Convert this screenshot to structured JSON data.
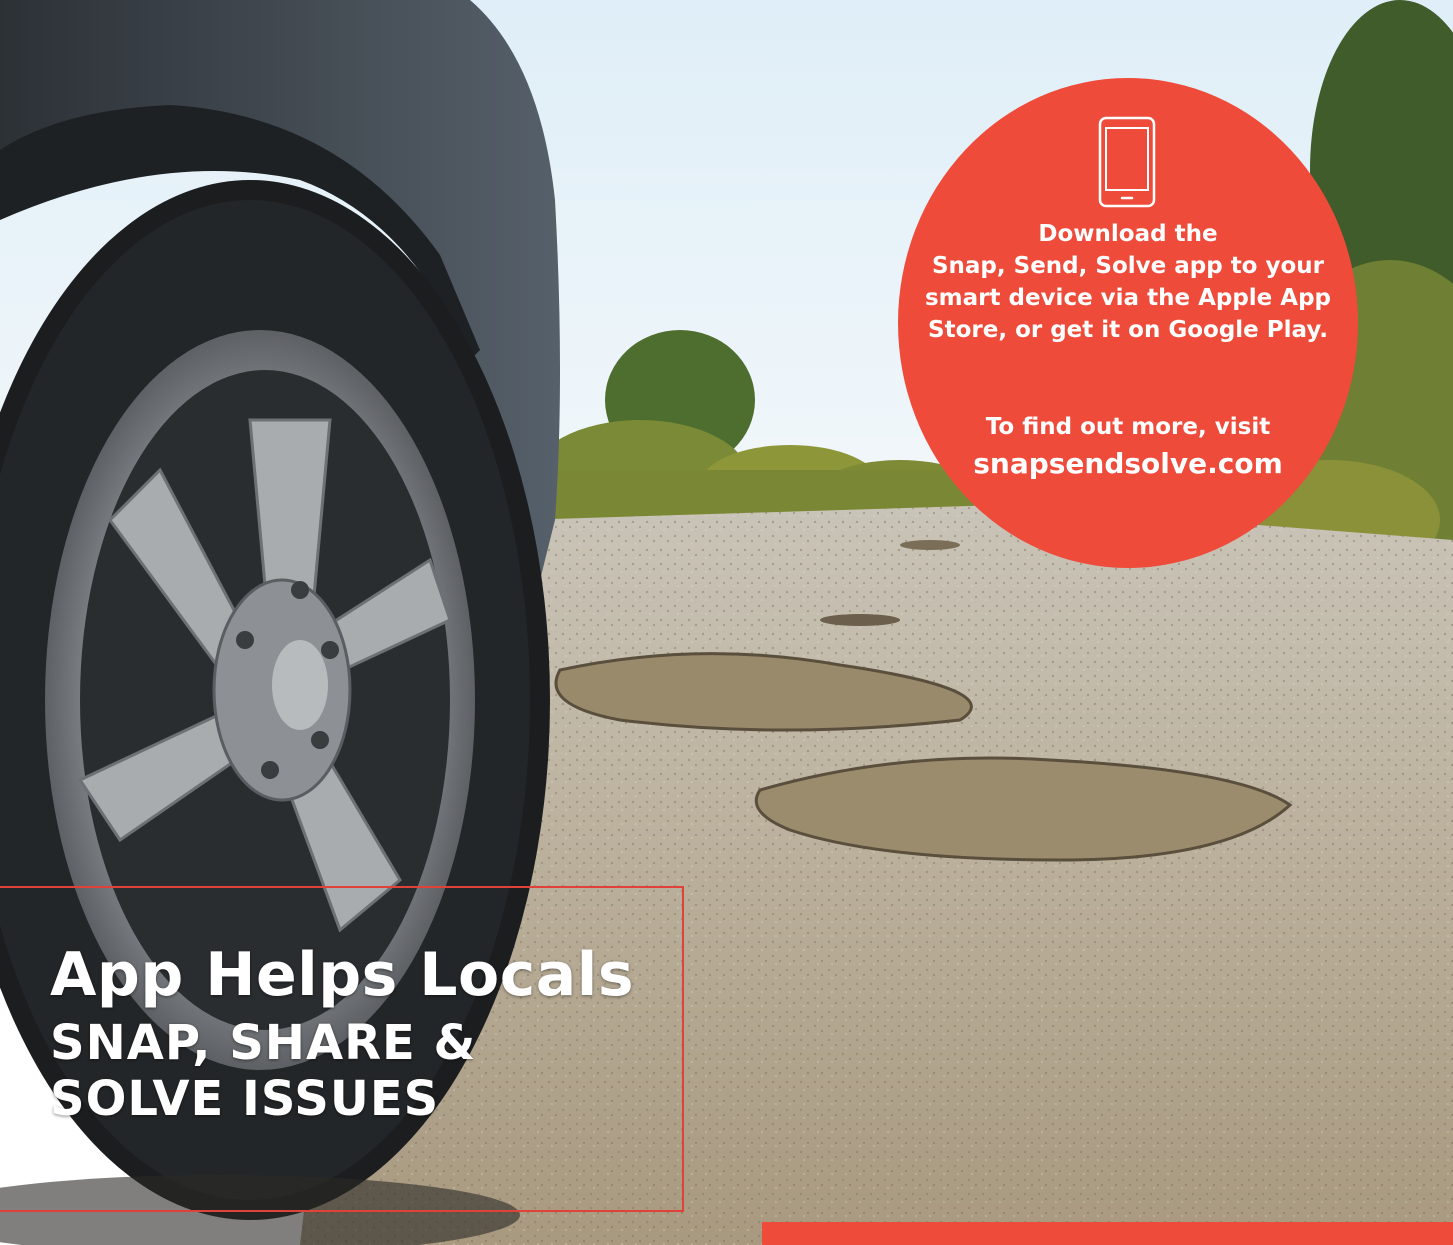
{
  "scene": {
    "description_icons": [
      "car-tyre-image",
      "potholed-road-image",
      "roadside-bushes-image"
    ]
  },
  "promo": {
    "icon": "smartphone-icon",
    "lines": [
      "Download the",
      "Snap, Send, Solve app to your",
      "smart device via the Apple App",
      "Store, or get it on Google Play."
    ],
    "more_lead": "To find out more, visit",
    "url": "snapsendsolve.com"
  },
  "headline": {
    "title": "App Helps Locals",
    "sub_line_1": "SNAP, SHARE &",
    "sub_line_2": "SOLVE ISSUES"
  },
  "colors": {
    "accent": "#ef4b3a",
    "text_on_accent": "#ffffff"
  }
}
